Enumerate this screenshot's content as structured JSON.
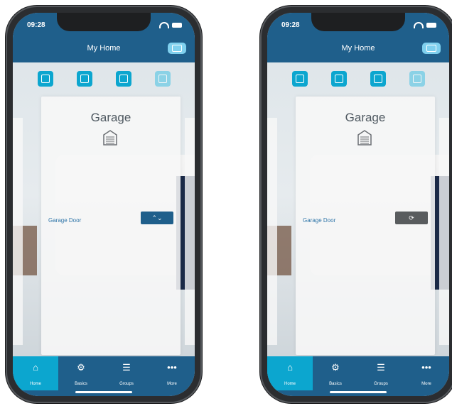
{
  "phones": [
    {
      "status_time": "09:28",
      "title": "My Home",
      "card_title": "Garage",
      "device_label": "Garage Door",
      "control_glyph": "⌃⌄",
      "control_state": "idle",
      "tabs": [
        "Home",
        "Basics",
        "Groups",
        "More"
      ],
      "tab_glyphs": [
        "⌂",
        "⚙",
        "☰",
        "•••"
      ]
    },
    {
      "status_time": "09:28",
      "title": "My Home",
      "card_title": "Garage",
      "device_label": "Garage Door",
      "control_glyph": "⟳",
      "control_state": "moving",
      "tabs": [
        "Home",
        "Basics",
        "Groups",
        "More"
      ],
      "tab_glyphs": [
        "⌂",
        "⚙",
        "☰",
        "•••"
      ]
    }
  ],
  "colors": {
    "header": "#1f5f8b",
    "accent": "#0ca6cf",
    "control_idle": "#1f5f8b",
    "control_moving": "#595c5e"
  }
}
